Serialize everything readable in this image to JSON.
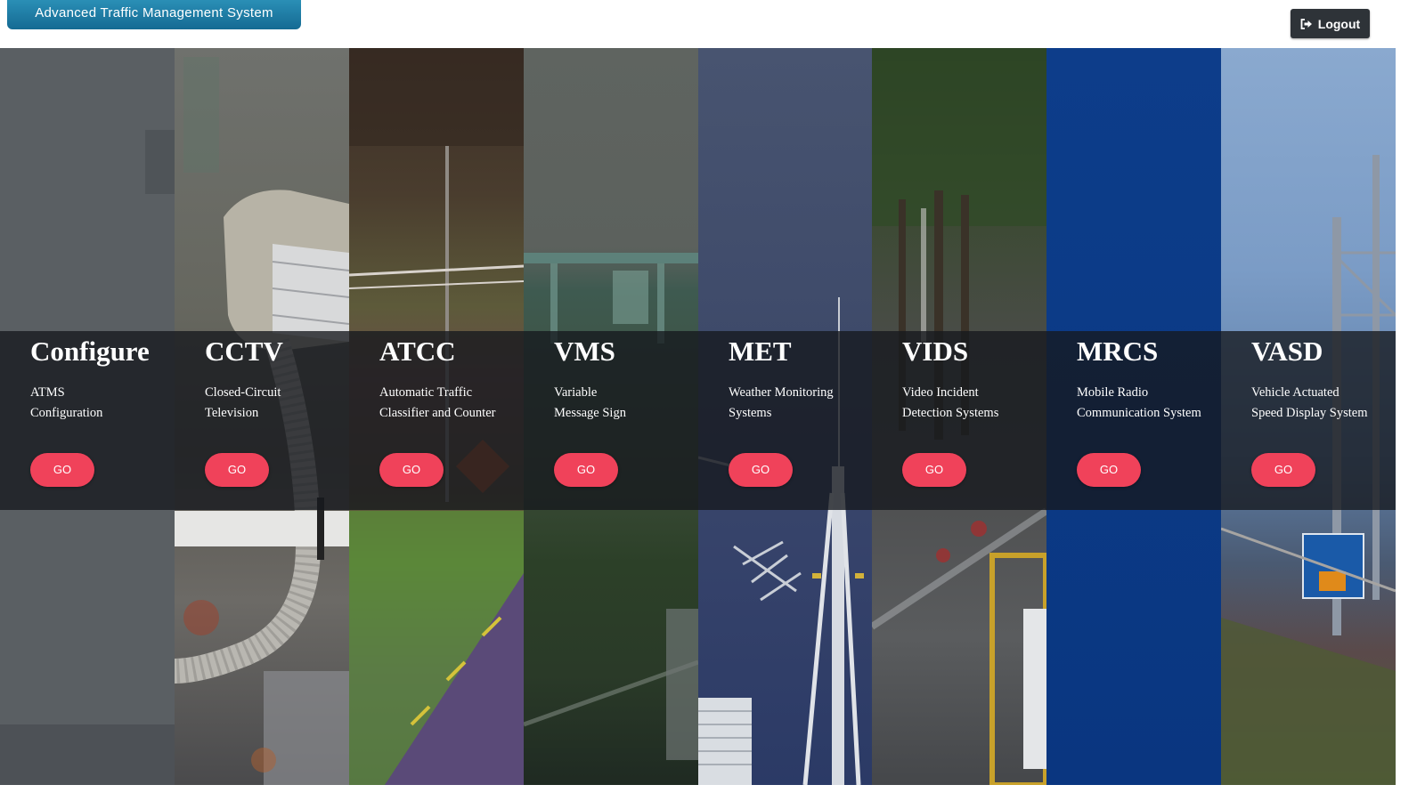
{
  "header": {
    "brand": "Advanced Traffic Management System",
    "logout_label": "Logout"
  },
  "modules": [
    {
      "title": "Configure",
      "line1": "ATMS",
      "line2": "Configuration",
      "go": "GO"
    },
    {
      "title": "CCTV",
      "line1": "Closed-Circuit",
      "line2": "Television",
      "go": "GO"
    },
    {
      "title": "ATCC",
      "line1": "Automatic Traffic",
      "line2": "Classifier and Counter",
      "go": "GO"
    },
    {
      "title": "VMS",
      "line1": "Variable",
      "line2": "Message Sign",
      "go": "GO"
    },
    {
      "title": "MET",
      "line1": "Weather Monitoring",
      "line2": "Systems",
      "go": "GO"
    },
    {
      "title": "VIDS",
      "line1": "Video Incident",
      "line2": "Detection Systems",
      "go": "GO"
    },
    {
      "title": "MRCS",
      "line1": "Mobile Radio",
      "line2": "Communication System",
      "go": "GO"
    },
    {
      "title": "VASD",
      "line1": "Vehicle Actuated",
      "line2": "Speed Display System",
      "go": "GO"
    }
  ],
  "colors": {
    "go_button": "#f0425a",
    "brand_bar": "#1d7ca6",
    "logout_button": "#2e3338"
  },
  "icons": {
    "logout": "sign-out-icon"
  }
}
